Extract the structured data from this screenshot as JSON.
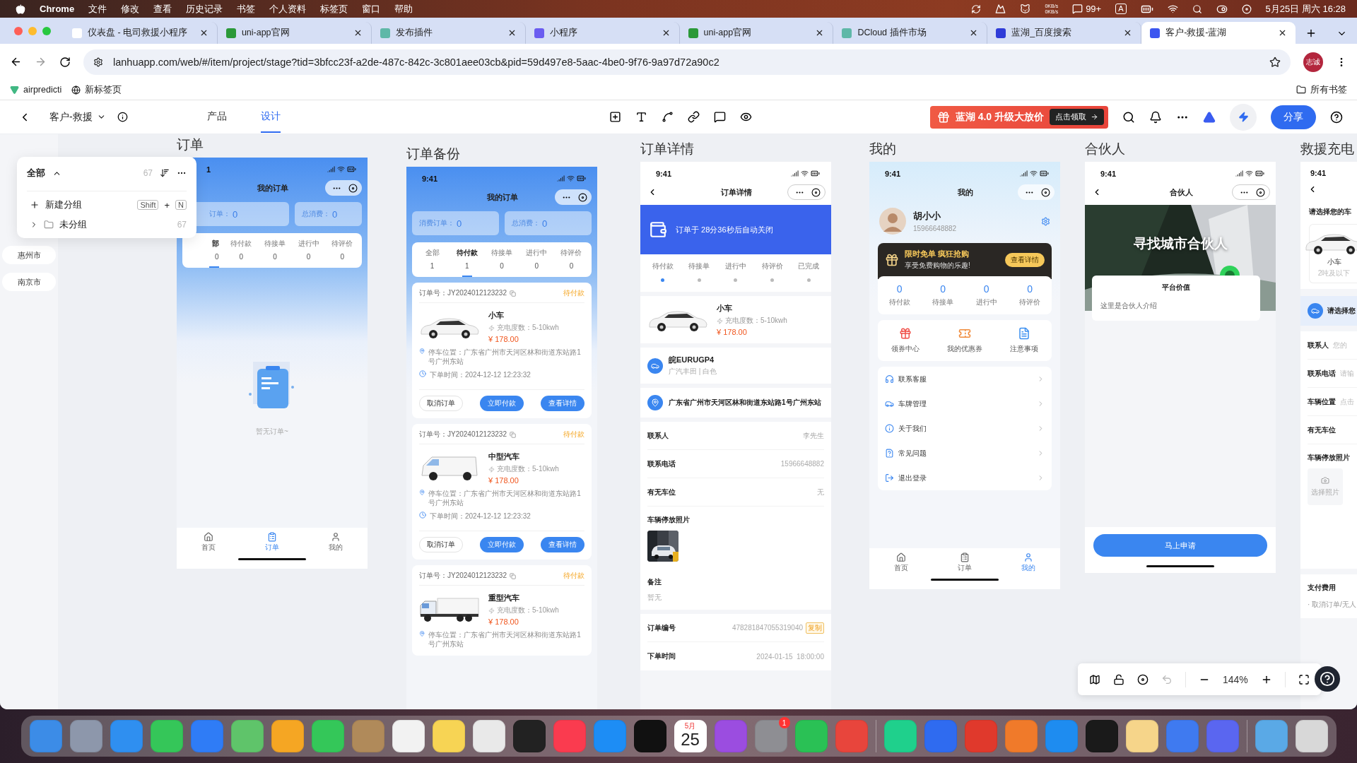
{
  "menubar": {
    "app": "Chrome",
    "menus": [
      "文件",
      "修改",
      "查看",
      "历史记录",
      "书签",
      "个人资料",
      "标签页",
      "窗口",
      "帮助"
    ],
    "net_up": "0KB/s",
    "net_down": "0KB/s",
    "badge": "99+",
    "input": "A",
    "clock": "5月25日 周六 16:28"
  },
  "tabs": [
    {
      "title": "仪表盘 - 电司救援小程序",
      "kind": "chart",
      "selected": false
    },
    {
      "title": "uni-app官网",
      "kind": "uni",
      "selected": false
    },
    {
      "title": "发布插件",
      "kind": "dcloud",
      "selected": false
    },
    {
      "title": "小程序",
      "kind": "link",
      "selected": false
    },
    {
      "title": "uni-app官网",
      "kind": "uni",
      "selected": false
    },
    {
      "title": "DCloud 插件市场",
      "kind": "dcloud",
      "selected": false
    },
    {
      "title": "蓝湖_百度搜索",
      "kind": "paw",
      "selected": false
    },
    {
      "title": "客户-救援-蓝湖",
      "kind": "lanhu",
      "selected": true
    }
  ],
  "address_bar": {
    "url": "lanhuapp.com/web/#/item/project/stage?tid=3bfcc23f-a2de-487c-842c-3c801aee03cb&pid=59d497e8-5aac-4be0-9f76-9a97d72a90c2"
  },
  "profile": "志诚",
  "bookmarks": [
    {
      "label": "airpredicti",
      "kind": "vue"
    },
    {
      "label": "新标签页",
      "kind": "globe"
    }
  ],
  "all_bookmarks": "所有书签",
  "toolbar": {
    "project": "客户-救援",
    "nav": [
      {
        "label": "产品",
        "selected": false
      },
      {
        "label": "设计",
        "selected": true
      }
    ],
    "promo": {
      "text": "蓝湖 4.0 升级大放价",
      "action": "点击领取"
    },
    "share": "分享"
  },
  "group_panel": {
    "title": "全部",
    "count": "67",
    "new_group": "新建分组",
    "shortcut": [
      "Shift",
      "+",
      "N"
    ],
    "groups": [
      {
        "label": "未分组",
        "count": "67",
        "expanded": false
      }
    ]
  },
  "cities": [
    "惠州市",
    "南京市"
  ],
  "artboards": [
    {
      "kind": "orders",
      "title": "订单",
      "time": "1",
      "header": "我的订单",
      "stats": [
        {
          "label": "订单：",
          "value": "0"
        },
        {
          "label": "总消费：",
          "value": "0"
        }
      ],
      "tabs": [
        {
          "label": "部",
          "count": "0",
          "selected": true
        },
        {
          "label": "待付款",
          "count": "0",
          "selected": false
        },
        {
          "label": "待接单",
          "count": "0",
          "selected": false
        },
        {
          "label": "进行中",
          "count": "0",
          "selected": false
        },
        {
          "label": "待评价",
          "count": "0",
          "selected": false
        }
      ],
      "empty": "暂无订单~",
      "tabbar": [
        {
          "label": "首页",
          "selected": false
        },
        {
          "label": "订单",
          "selected": true
        },
        {
          "label": "我的",
          "selected": false
        }
      ]
    },
    {
      "kind": "orders",
      "title": "订单备份",
      "time": "9:41",
      "header": "我的订单",
      "stats": [
        {
          "label": "消费订单：",
          "value": "0"
        },
        {
          "label": "总消费：",
          "value": "0"
        }
      ],
      "tabs": [
        {
          "label": "全部",
          "count": "1",
          "selected": false
        },
        {
          "label": "待付款",
          "count": "1",
          "selected": true
        },
        {
          "label": "待接单",
          "count": "0",
          "selected": false
        },
        {
          "label": "进行中",
          "count": "0",
          "selected": false
        },
        {
          "label": "待评价",
          "count": "0",
          "selected": false
        }
      ],
      "orders": [
        {
          "number": "订单号：JY2024012123232",
          "status": "待付款",
          "vehicle": "小车",
          "kind": "car",
          "energy": "充电度数：5-10kwh",
          "price": "¥ 178.00",
          "location": "停车位置：广东省广州市天河区林和街道东站路1号广州东站",
          "time": "下单时间：2024-12-12 12:23:32",
          "actions": [
            {
              "label": "取消订单",
              "kind": "outline"
            },
            {
              "label": "立即付款",
              "kind": "primary"
            },
            {
              "label": "查看详情",
              "kind": "primary"
            }
          ]
        },
        {
          "number": "订单号：JY2024012123232",
          "status": "待付款",
          "vehicle": "中型汽车",
          "kind": "van",
          "energy": "充电度数：5-10kwh",
          "price": "¥ 178.00",
          "location": "停车位置：广东省广州市天河区林和街道东站路1号广州东站",
          "time": "下单时间：2024-12-12 12:23:32",
          "actions": [
            {
              "label": "取消订单",
              "kind": "outline"
            },
            {
              "label": "立即付款",
              "kind": "primary"
            },
            {
              "label": "查看详情",
              "kind": "primary"
            }
          ]
        },
        {
          "number": "订单号：JY2024012123232",
          "status": "待付款",
          "vehicle": "重型汽车",
          "kind": "truck",
          "energy": "充电度数：5-10kwh",
          "price": "¥ 178.00",
          "location": "停车位置：广东省广州市天河区林和街道东站路1号广州东站"
        }
      ]
    },
    {
      "kind": "detail",
      "title": "订单详情",
      "time": "9:41",
      "header": "订单详情",
      "banner": "订单于 28分36秒后自动关闭",
      "steps": [
        {
          "label": "待付款",
          "selected": true
        },
        {
          "label": "待接单",
          "selected": false
        },
        {
          "label": "进行中",
          "selected": false
        },
        {
          "label": "待评价",
          "selected": false
        },
        {
          "label": "已完成",
          "selected": false
        }
      ],
      "vehicle": {
        "name": "小车",
        "energy": "充电度数：5-10kwh",
        "price": "¥ 178.00"
      },
      "plate": {
        "number": "皖EURUGP4",
        "info": "广汽丰田 | 白色"
      },
      "address": "广东省广州市天河区林和街道东站路1号广州东站",
      "fields": [
        {
          "label": "联系人",
          "value": "李先生"
        },
        {
          "label": "联系电话",
          "value": "15966648882"
        },
        {
          "label": "有无车位",
          "value": "无"
        }
      ],
      "photo_label": "车辆停放照片",
      "remark_label": "备注",
      "remark": "暂无",
      "order_no": {
        "label": "订单编号",
        "value": "478281847055319040",
        "action": "复制"
      },
      "order_time": {
        "label": "下单时间",
        "value": "2024-01-15  18:00:00"
      }
    },
    {
      "kind": "mine",
      "title": "我的",
      "time": "9:41",
      "header": "我的",
      "user": {
        "name": "胡小小",
        "phone": "15966648882"
      },
      "promo": {
        "title": "限时免单 疯狂抢购",
        "subtitle": "享受免费购物的乐趣!",
        "action": "查看详情"
      },
      "counts": [
        {
          "value": "0",
          "label": "待付款"
        },
        {
          "value": "0",
          "label": "待接单"
        },
        {
          "value": "0",
          "label": "进行中"
        },
        {
          "value": "0",
          "label": "待评价"
        }
      ],
      "shortcuts": [
        "领券中心",
        "我的优惠券",
        "注意事项"
      ],
      "menu": [
        "联系客服",
        "车牌管理",
        "关于我们",
        "常见问题",
        "退出登录"
      ],
      "tabbar": [
        {
          "label": "首页",
          "selected": false
        },
        {
          "label": "订单",
          "selected": false
        },
        {
          "label": "我的",
          "selected": true
        }
      ]
    },
    {
      "kind": "partner",
      "title": "合伙人",
      "time": "9:41",
      "header": "合伙人",
      "hero": "寻找城市合伙人",
      "card": {
        "title": "平台价值",
        "body": "这里是合伙人介绍"
      },
      "button": "马上申请"
    },
    {
      "kind": "rescue",
      "title": "救援充电",
      "time": "9:41",
      "section": "请选择您的车",
      "vehicle": {
        "name": "小车",
        "note": "2吨及以下"
      },
      "select": "请选择您",
      "fields": [
        {
          "label": "联系人",
          "placeholder": "您的"
        },
        {
          "label": "联系电话",
          "placeholder": "请输"
        },
        {
          "label": "车辆位置",
          "placeholder": "点击"
        },
        {
          "label": "有无车位"
        }
      ],
      "photo_label": "车辆停放照片",
      "photo_button": "选择照片",
      "pay_title": "支付费用",
      "pay_note": "· 取消订单/无人"
    }
  ],
  "zoom_bar": {
    "zoom": "144%"
  },
  "dock": [
    [
      {
        "kind": "app",
        "color": "#3c8ce7"
      },
      {
        "kind": "app",
        "color": "#8d97ab"
      },
      {
        "kind": "app",
        "color": "#2f8ff0"
      },
      {
        "kind": "app",
        "color": "#35c659"
      },
      {
        "kind": "app",
        "color": "#2f7cf6"
      },
      {
        "kind": "app",
        "color": "#5fc46a"
      },
      {
        "kind": "app",
        "color": "#f5a623"
      },
      {
        "kind": "app",
        "color": "#34c759"
      },
      {
        "kind": "app",
        "color": "#b08a5a"
      },
      {
        "kind": "app",
        "color": "#f2f2f2"
      },
      {
        "kind": "app",
        "color": "#f7d454"
      },
      {
        "kind": "app",
        "color": "#e9e9e9"
      },
      {
        "kind": "app",
        "color": "#222222"
      },
      {
        "kind": "app",
        "color": "#fa3b4f"
      },
      {
        "kind": "app",
        "color": "#1d8df5"
      },
      {
        "kind": "app",
        "color": "#111111"
      },
      {
        "kind": "calendar",
        "month": "5月",
        "day": "25"
      },
      {
        "kind": "app",
        "color": "#9b4de0"
      },
      {
        "kind": "app",
        "color": "#8e8e93",
        "badge": "1"
      },
      {
        "kind": "app",
        "color": "#2ac155"
      },
      {
        "kind": "app",
        "color": "#e8453c"
      }
    ],
    [
      {
        "kind": "app",
        "color": "#1fd08c"
      },
      {
        "kind": "app",
        "color": "#2f6bf0"
      },
      {
        "kind": "app",
        "color": "#e0392c"
      },
      {
        "kind": "app",
        "color": "#f07a2a"
      },
      {
        "kind": "app",
        "color": "#1e8cf0"
      },
      {
        "kind": "app",
        "color": "#1a1a1a"
      },
      {
        "kind": "app",
        "color": "#f6d58a"
      },
      {
        "kind": "app",
        "color": "#3f7af0"
      },
      {
        "kind": "app",
        "color": "#5a66f0"
      }
    ],
    [
      {
        "kind": "app",
        "color": "#5aa9e6"
      },
      {
        "kind": "app",
        "color": "#d8d8d8"
      }
    ]
  ]
}
